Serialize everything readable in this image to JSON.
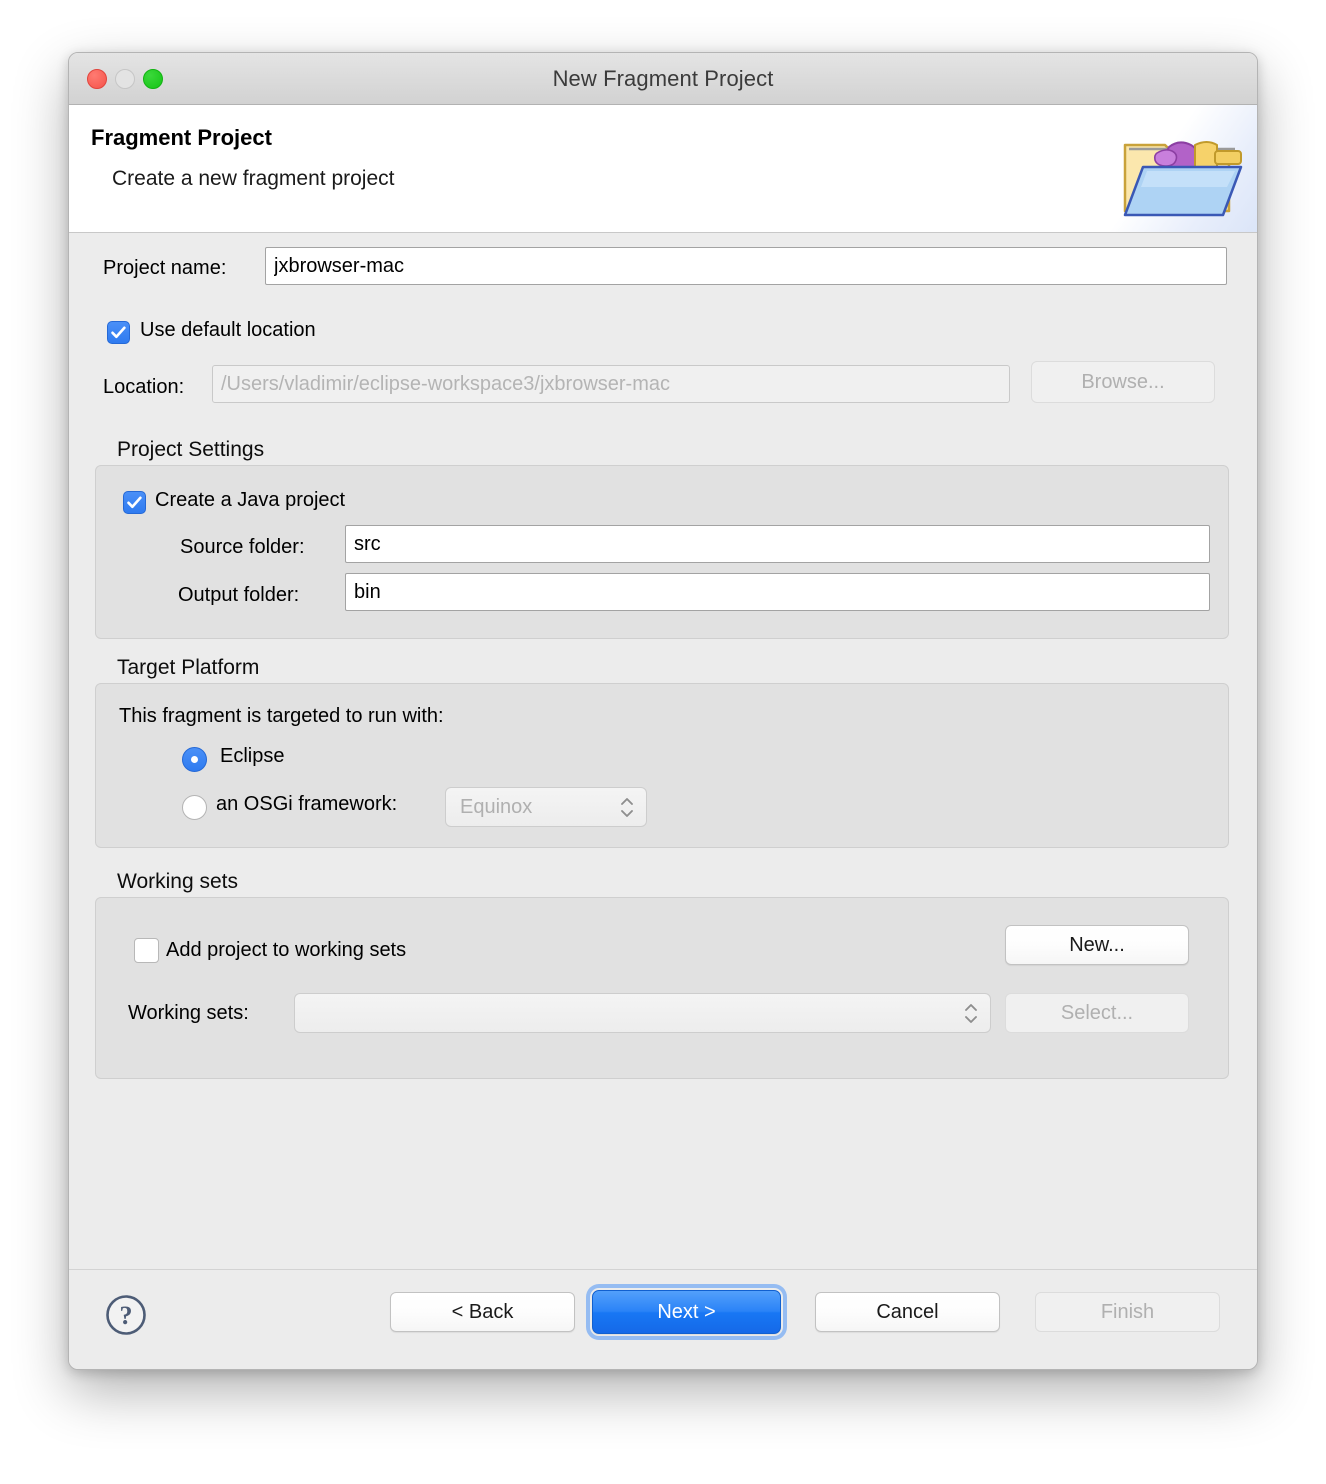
{
  "window": {
    "title": "New Fragment Project",
    "traffic_lights": [
      "close",
      "minimize",
      "zoom"
    ]
  },
  "banner": {
    "title": "Fragment Project",
    "subtitle": "Create a new fragment project",
    "icon": "fragment-project-folder-plug-icon"
  },
  "form": {
    "project_name_label": "Project name:",
    "project_name_value": "jxbrowser-mac",
    "use_default_location_label": "Use default location",
    "use_default_location_checked": true,
    "location_label": "Location:",
    "location_value": "/Users/vladimir/eclipse-workspace3/jxbrowser-mac",
    "browse_label": "Browse..."
  },
  "project_settings": {
    "group_label": "Project Settings",
    "create_java_project_label": "Create a Java project",
    "create_java_project_checked": true,
    "source_folder_label": "Source folder:",
    "source_folder_value": "src",
    "output_folder_label": "Output folder:",
    "output_folder_value": "bin"
  },
  "target_platform": {
    "group_label": "Target Platform",
    "prompt": "This fragment is targeted to run with:",
    "options": [
      {
        "label": "Eclipse",
        "selected": true
      },
      {
        "label": "an OSGi framework:",
        "selected": false
      }
    ],
    "osgi_framework_value": "Equinox"
  },
  "working_sets": {
    "group_label": "Working sets",
    "add_to_working_sets_label": "Add project to working sets",
    "add_to_working_sets_checked": false,
    "new_label": "New...",
    "working_sets_label": "Working sets:",
    "working_sets_value": "",
    "select_label": "Select..."
  },
  "footer": {
    "help_icon": "question-mark-help-icon",
    "back_label": "< Back",
    "next_label": "Next >",
    "cancel_label": "Cancel",
    "finish_label": "Finish"
  },
  "colors": {
    "accent": "#2f7bf0",
    "window_bg": "#ececec",
    "group_bg": "#e1e1e1",
    "banner_bg": "#ffffff"
  }
}
